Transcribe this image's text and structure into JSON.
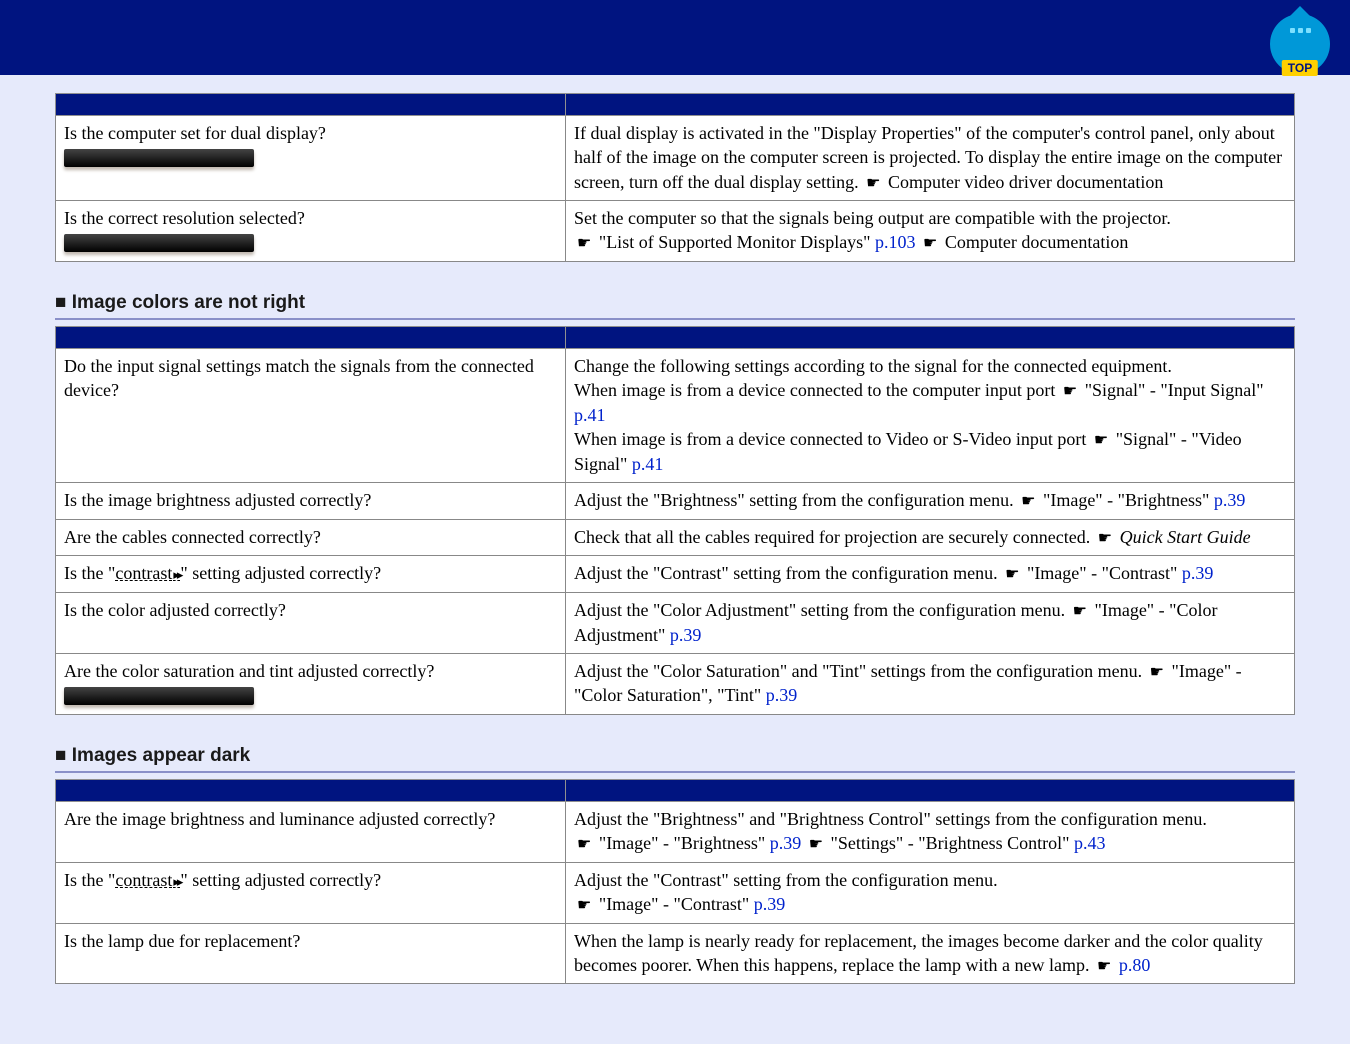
{
  "header": {
    "badge_label": "TOP"
  },
  "intro_table": {
    "rows": [
      {
        "q": "Is the computer set for dual display?",
        "a_parts": [
          {
            "t": "text",
            "v": "If dual display is activated in the \"Display Properties\" of the computer's control panel, only about half of the image on the computer screen is projected. To display the entire image on the computer screen, turn off the dual display setting. "
          },
          {
            "t": "bullet"
          },
          {
            "t": "text",
            "v": " Computer video driver documentation"
          }
        ]
      },
      {
        "q": "Is the correct resolution selected?",
        "a_parts": [
          {
            "t": "text",
            "v": "Set the computer so that the signals being output are compatible with the projector."
          },
          {
            "t": "br"
          },
          {
            "t": "bullet"
          },
          {
            "t": "text",
            "v": " \"List of Supported Monitor Displays\" "
          },
          {
            "t": "link",
            "v": "p.103"
          },
          {
            "t": "text",
            "v": " "
          },
          {
            "t": "bullet"
          },
          {
            "t": "text",
            "v": " Computer documentation"
          }
        ]
      }
    ]
  },
  "sections": [
    {
      "title": "Image colors are not right",
      "rows": [
        {
          "q_parts": [
            {
              "t": "text",
              "v": "Do the input signal settings match the signals from the connected device?"
            }
          ],
          "a_parts": [
            {
              "t": "text",
              "v": "Change the following settings according to the signal for the connected equipment."
            },
            {
              "t": "br"
            },
            {
              "t": "text",
              "v": "When image is from a device connected to the computer input port "
            },
            {
              "t": "bullet"
            },
            {
              "t": "text",
              "v": " \"Signal\" - \"Input Signal\" "
            },
            {
              "t": "link",
              "v": "p.41"
            },
            {
              "t": "br"
            },
            {
              "t": "text",
              "v": "When image is from a device connected to Video or S-Video input port "
            },
            {
              "t": "bullet"
            },
            {
              "t": "text",
              "v": " \"Signal\" - \"Video Signal\" "
            },
            {
              "t": "link",
              "v": "p.41"
            }
          ]
        },
        {
          "q_parts": [
            {
              "t": "text",
              "v": "Is the image brightness adjusted correctly?"
            }
          ],
          "a_parts": [
            {
              "t": "text",
              "v": "Adjust the \"Brightness\" setting from the configuration menu. "
            },
            {
              "t": "bullet"
            },
            {
              "t": "text",
              "v": " \"Image\" - \"Brightness\" "
            },
            {
              "t": "link",
              "v": "p.39"
            }
          ]
        },
        {
          "q_parts": [
            {
              "t": "text",
              "v": "Are the cables connected correctly?"
            }
          ],
          "a_parts": [
            {
              "t": "text",
              "v": "Check that all the cables required for projection are securely connected. "
            },
            {
              "t": "bullet"
            },
            {
              "t": "text",
              "v": " "
            },
            {
              "t": "guide",
              "v": "Quick Start Guide"
            }
          ]
        },
        {
          "q_parts": [
            {
              "t": "text",
              "v": "Is the \""
            },
            {
              "t": "gloss",
              "v": "contrast"
            },
            {
              "t": "text",
              "v": "\" setting adjusted correctly?"
            }
          ],
          "a_parts": [
            {
              "t": "text",
              "v": "Adjust the \"Contrast\" setting from the configuration menu. "
            },
            {
              "t": "bullet"
            },
            {
              "t": "text",
              "v": " \"Image\" - \"Contrast\" "
            },
            {
              "t": "link",
              "v": "p.39"
            }
          ]
        },
        {
          "q_parts": [
            {
              "t": "text",
              "v": "Is the color adjusted correctly?"
            }
          ],
          "a_parts": [
            {
              "t": "text",
              "v": "Adjust the \"Color Adjustment\" setting from the configuration menu. "
            },
            {
              "t": "bullet"
            },
            {
              "t": "text",
              "v": " \"Image\" - \"Color Adjustment\" "
            },
            {
              "t": "link",
              "v": "p.39"
            }
          ]
        },
        {
          "q_parts": [
            {
              "t": "text",
              "v": "Are the color saturation and tint adjusted correctly?"
            }
          ],
          "a_parts": [
            {
              "t": "text",
              "v": "Adjust the \"Color Saturation\" and \"Tint\" settings from the configuration menu. "
            },
            {
              "t": "bullet"
            },
            {
              "t": "text",
              "v": " \"Image\" - \"Color Saturation\", \"Tint\" "
            },
            {
              "t": "link",
              "v": "p.39"
            }
          ]
        }
      ]
    },
    {
      "title": "Images appear dark",
      "rows": [
        {
          "q_parts": [
            {
              "t": "text",
              "v": "Are the image brightness and luminance adjusted correctly?"
            }
          ],
          "a_parts": [
            {
              "t": "text",
              "v": "Adjust the \"Brightness\" and \"Brightness Control\" settings from the configuration menu."
            },
            {
              "t": "br"
            },
            {
              "t": "bullet"
            },
            {
              "t": "text",
              "v": " \"Image\" - \"Brightness\" "
            },
            {
              "t": "link",
              "v": "p.39"
            },
            {
              "t": "text",
              "v": " "
            },
            {
              "t": "bullet"
            },
            {
              "t": "text",
              "v": " \"Settings\" - \"Brightness Control\" "
            },
            {
              "t": "link",
              "v": "p.43"
            }
          ]
        },
        {
          "q_parts": [
            {
              "t": "text",
              "v": "Is the \""
            },
            {
              "t": "gloss",
              "v": "contrast"
            },
            {
              "t": "text",
              "v": "\" setting adjusted correctly?"
            }
          ],
          "a_parts": [
            {
              "t": "text",
              "v": "Adjust the \"Contrast\" setting from the configuration menu."
            },
            {
              "t": "br"
            },
            {
              "t": "bullet"
            },
            {
              "t": "text",
              "v": " \"Image\" - \"Contrast\" "
            },
            {
              "t": "link",
              "v": "p.39"
            }
          ]
        },
        {
          "q_parts": [
            {
              "t": "text",
              "v": "Is the lamp due for replacement?"
            }
          ],
          "a_parts": [
            {
              "t": "text",
              "v": "When the lamp is nearly ready for replacement, the images become darker and the color quality becomes poorer. When this happens, replace the lamp with a new lamp. "
            },
            {
              "t": "bullet"
            },
            {
              "t": "text",
              "v": " "
            },
            {
              "t": "link",
              "v": "p.80"
            }
          ]
        }
      ]
    }
  ]
}
